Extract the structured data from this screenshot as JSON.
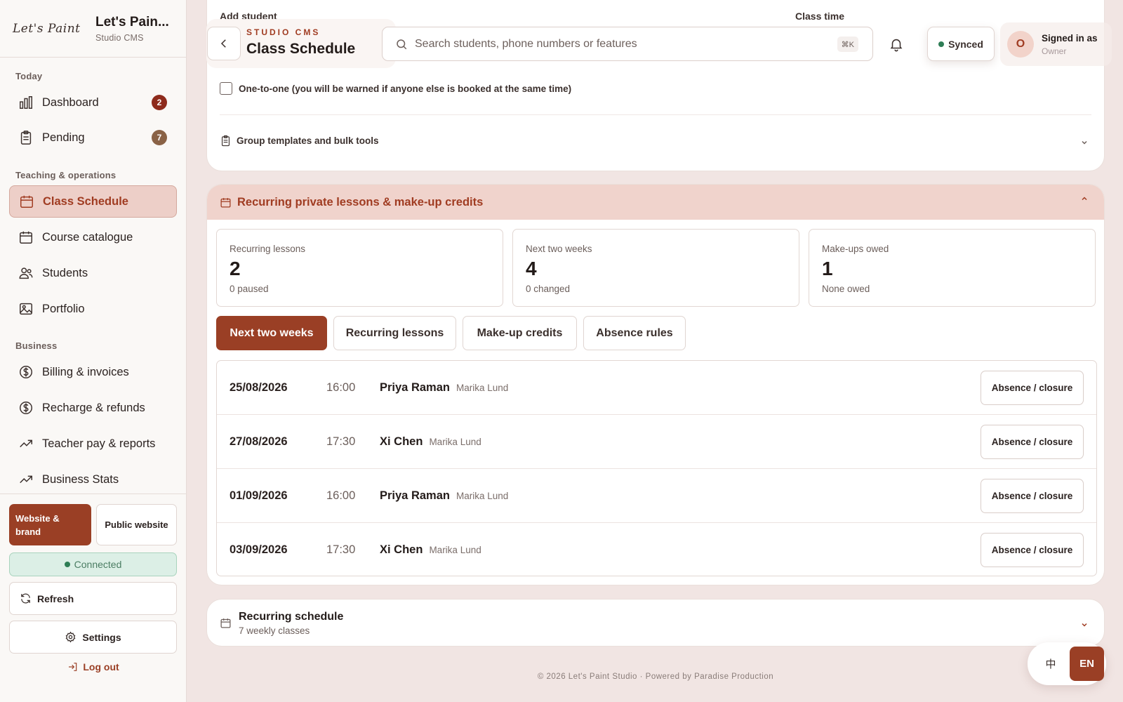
{
  "brand": {
    "logo_text": "Let's Paint",
    "name": "Let's Pain...",
    "subtitle": "Studio CMS"
  },
  "sidebar": {
    "sections": {
      "today": "Today",
      "teaching": "Teaching & operations",
      "business": "Business"
    },
    "items": [
      {
        "label": "Dashboard",
        "icon": "bar-chart-icon",
        "badge": "2"
      },
      {
        "label": "Pending",
        "icon": "clipboard-icon",
        "badge": "7"
      },
      {
        "label": "Class Schedule",
        "icon": "calendar-icon",
        "active": true
      },
      {
        "label": "Course catalogue",
        "icon": "calendar-icon"
      },
      {
        "label": "Students",
        "icon": "users-icon"
      },
      {
        "label": "Portfolio",
        "icon": "image-icon"
      },
      {
        "label": "Billing & invoices",
        "icon": "dollar-circle-icon"
      },
      {
        "label": "Recharge & refunds",
        "icon": "dollar-circle-icon"
      },
      {
        "label": "Teacher pay & reports",
        "icon": "trend-icon"
      },
      {
        "label": "Business Stats",
        "icon": "trend-icon"
      }
    ],
    "website_button": "Website & brand",
    "public_button": "Public website",
    "connection_status": "Connected",
    "refresh": "Refresh",
    "settings": "Settings",
    "logout": "Log out"
  },
  "header": {
    "eyebrow": "STUDIO CMS",
    "title": "Class Schedule",
    "search_placeholder": "Search students, phone numbers or features",
    "shortcut": "⌘K",
    "sync_status": "Synced",
    "user": {
      "initial": "O",
      "line1": "Signed in as",
      "role": "Owner"
    }
  },
  "top_card": {
    "add_student_label": "Add student",
    "class_time_label": "Class time",
    "one_to_one_label": "One-to-one (you will be warned if anyone else is booked at the same time)",
    "group_tools_label": "Group templates and bulk tools"
  },
  "recurring_card": {
    "title": "Recurring private lessons & make-up credits",
    "stats": [
      {
        "label": "Recurring lessons",
        "value": "2",
        "sub": "0 paused"
      },
      {
        "label": "Next two weeks",
        "value": "4",
        "sub": "0 changed"
      },
      {
        "label": "Make-ups owed",
        "value": "1",
        "sub": "None owed"
      }
    ],
    "tabs": [
      "Next two weeks",
      "Recurring lessons",
      "Make-up credits",
      "Absence rules"
    ],
    "active_tab": "Next two weeks",
    "lessons": [
      {
        "date": "25/08/2026",
        "time": "16:00",
        "student": "Priya Raman",
        "teacher": "Marika Lund",
        "action": "Absence / closure"
      },
      {
        "date": "27/08/2026",
        "time": "17:30",
        "student": "Xi Chen",
        "teacher": "Marika Lund",
        "action": "Absence / closure"
      },
      {
        "date": "01/09/2026",
        "time": "16:00",
        "student": "Priya Raman",
        "teacher": "Marika Lund",
        "action": "Absence / closure"
      },
      {
        "date": "03/09/2026",
        "time": "17:30",
        "student": "Xi Chen",
        "teacher": "Marika Lund",
        "action": "Absence / closure"
      }
    ]
  },
  "schedule_card": {
    "title": "Recurring schedule",
    "subtitle": "7 weekly classes"
  },
  "footer": "© 2026 Let's Paint Studio · Powered by Paradise Production",
  "language": {
    "zh": "中",
    "en": "EN",
    "active": "EN"
  },
  "colors": {
    "accent": "#9a3f25",
    "accent_soft": "#f0d3cc",
    "success": "#2e7d55",
    "badge_red": "#8e2b1c",
    "badge_brown": "#8a6246"
  }
}
